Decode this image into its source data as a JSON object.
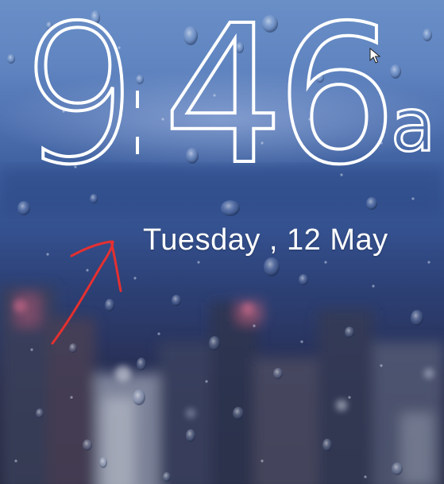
{
  "lockscreen": {
    "time": {
      "hours": "9",
      "minutes": "46",
      "ampm": "a"
    },
    "date": {
      "text": "Tuesday , 12 May"
    }
  },
  "annotation": {
    "icon": "red-arrow-icon",
    "color": "#e53030"
  },
  "pointer": {
    "icon": "mouse-cursor-icon"
  },
  "colors": {
    "text": "#ffffff",
    "sky": "#5f84c0",
    "ground": "#262a48"
  }
}
